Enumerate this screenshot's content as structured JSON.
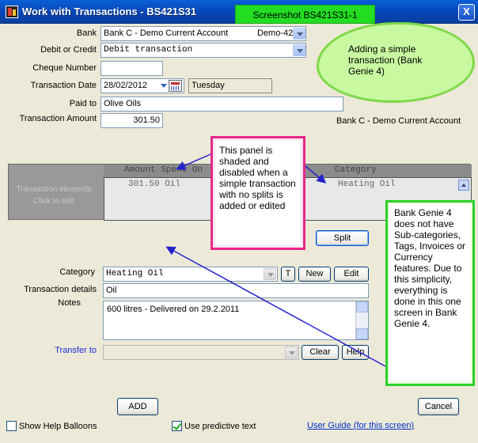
{
  "window": {
    "title": "Work with Transactions - BS421S31",
    "screenshot_tag": "Screenshot BS421S31-1",
    "close_glyph": "X"
  },
  "form": {
    "bank_label": "Bank",
    "bank_value": "Bank C - Demo Current Account",
    "bank_code": "Demo-42",
    "debit_credit_label": "Debit or Credit",
    "debit_credit_value": "Debit transaction",
    "cheque_label": "Cheque Number",
    "cheque_value": "",
    "date_label": "Transaction Date",
    "date_value": "28/02/2012",
    "day_value": "Tuesday",
    "paid_to_label": "Paid to",
    "paid_to_value": "Olive Oils",
    "amount_label": "Transaction Amount",
    "amount_value": "301.50",
    "bank_summary": "Bank C - Demo Current Account"
  },
  "splits_panel": {
    "side_label_line1": "Transaction elements",
    "side_label_line2": "Click to edit",
    "col_amount": "Amount Spent On",
    "col_category": "Category",
    "row_amount": "301.50 Oil",
    "row_category": "Heating Oil"
  },
  "split_button": "Split",
  "details": {
    "category_label": "Category",
    "category_value": "Heating Oil",
    "t_button": "T",
    "new_button": "New",
    "edit_button": "Edit",
    "txn_details_label": "Transaction details",
    "txn_details_value": "Oil",
    "notes_label": "Notes",
    "notes_value": "600 litres - Delivered on 29.2.2011",
    "transfer_label": "Transfer to",
    "transfer_value": "",
    "clear_button": "Clear",
    "help_button": "Help"
  },
  "footer": {
    "add_button": "ADD",
    "cancel_button": "Cancel",
    "show_help_label": "Show Help Balloons",
    "show_help_checked": false,
    "predictive_label": "Use predictive text",
    "predictive_checked": true,
    "user_guide_link": "User Guide (for this screen)"
  },
  "annotations": {
    "cloud_text": "Adding a simple transaction (Bank Genie 4)",
    "pink_text": "This panel is shaded and disabled when a simple transaction with no splits is added or edited",
    "green_text": "Bank Genie 4 does not have Sub-categories, Tags, Invoices or Currency features. Due to this simplicity, everything is done in this one screen in Bank Genie 4."
  },
  "colors": {
    "titlebar": "#0a4fc8",
    "window_bg": "#ece9d8",
    "screenshot_tag": "#22dd22",
    "cloud_fill": "#c8f8a0",
    "pink_border": "#e82888",
    "green_border": "#2bd12b",
    "arrow": "#2222cc"
  }
}
